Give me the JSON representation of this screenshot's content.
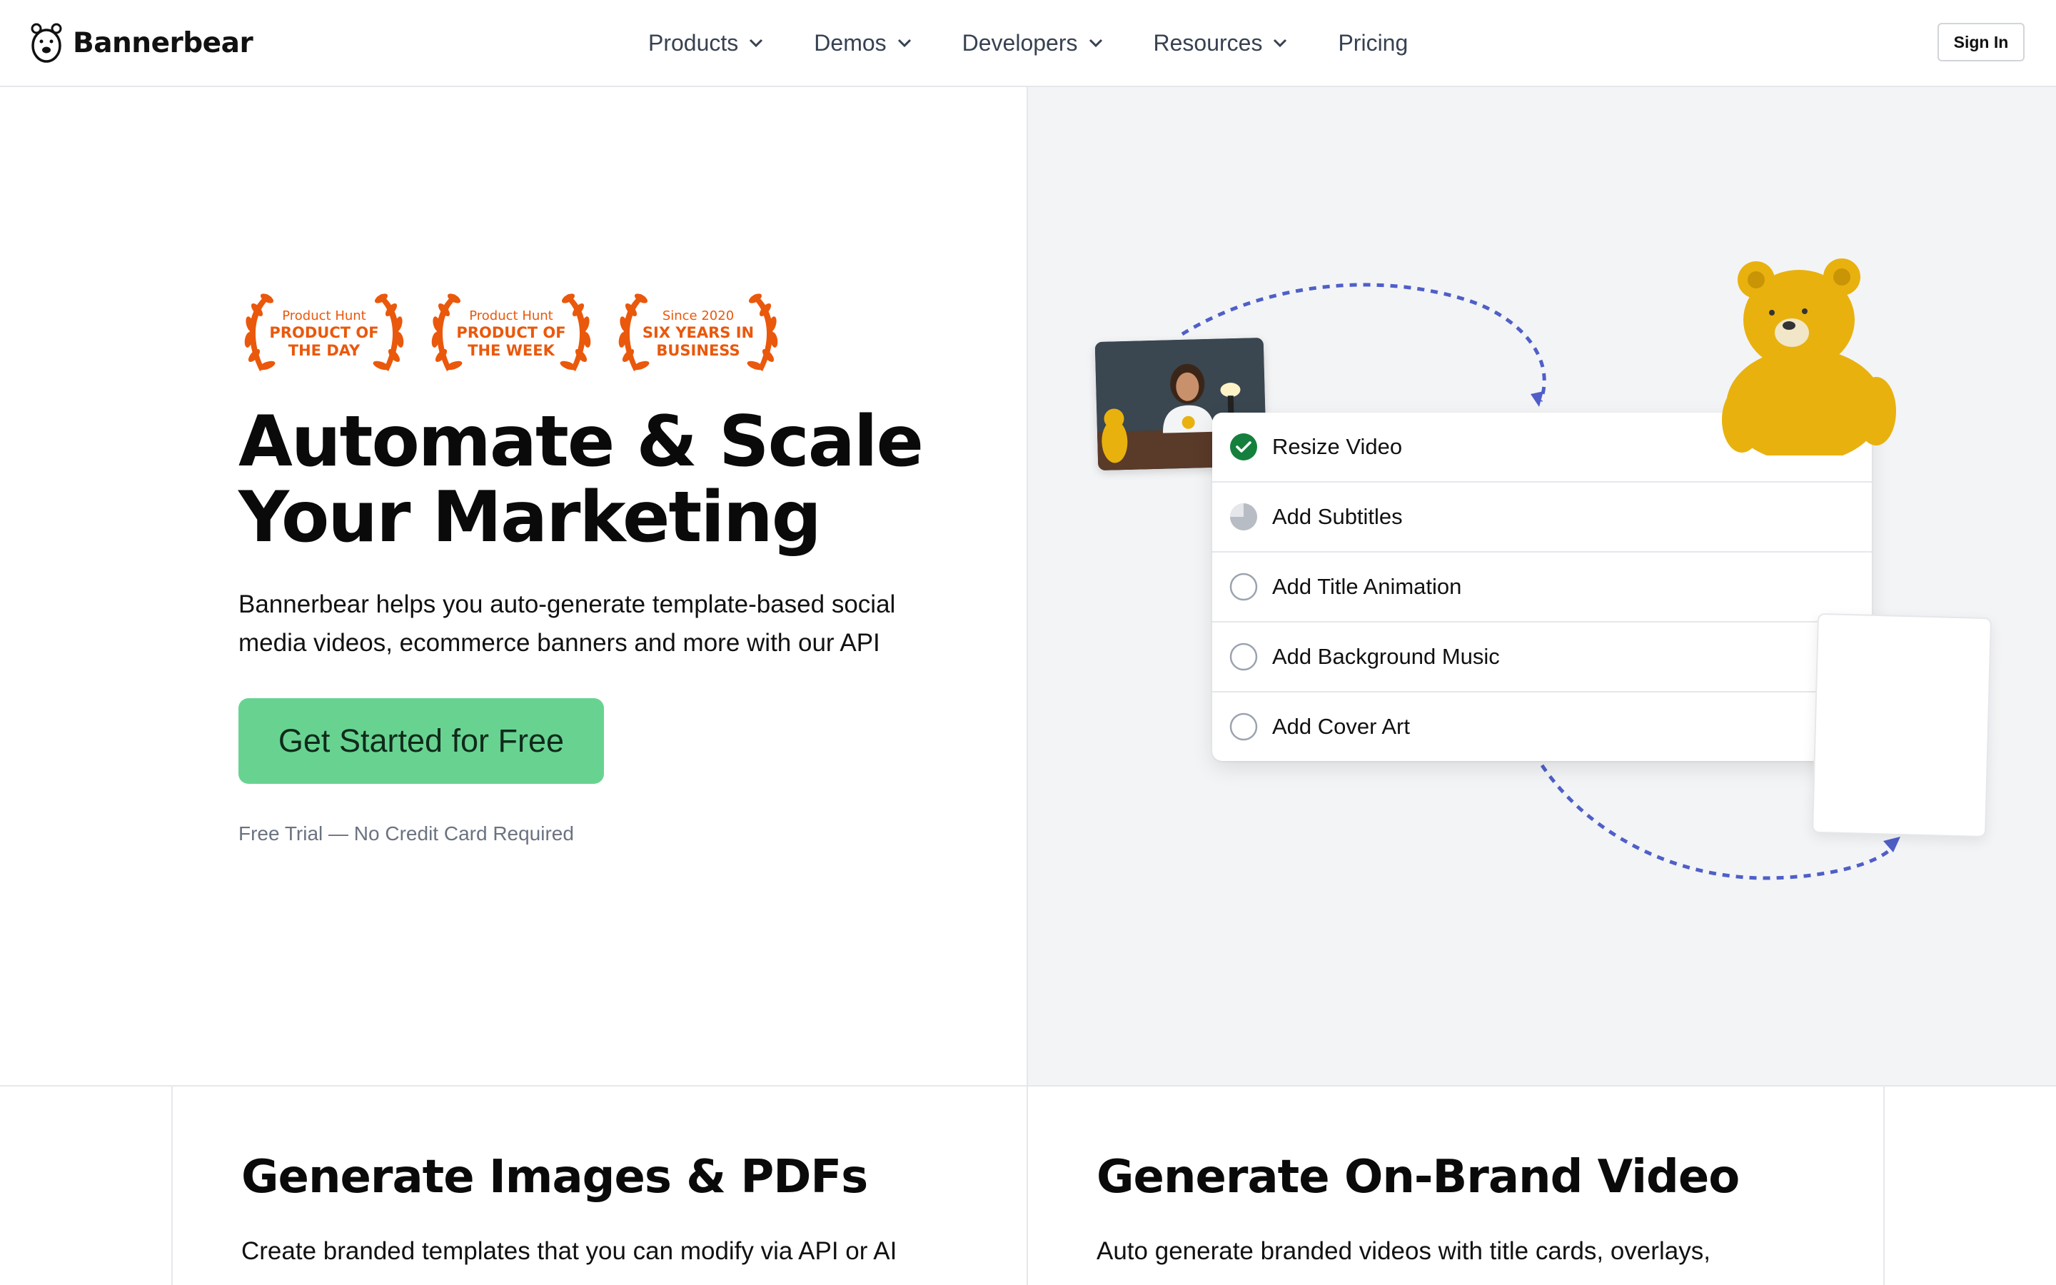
{
  "header": {
    "brand": "Bannerbear",
    "nav": [
      {
        "label": "Products",
        "dropdown": true
      },
      {
        "label": "Demos",
        "dropdown": true
      },
      {
        "label": "Developers",
        "dropdown": true
      },
      {
        "label": "Resources",
        "dropdown": true
      },
      {
        "label": "Pricing",
        "dropdown": false
      }
    ],
    "sign_in": "Sign In"
  },
  "hero": {
    "badges": [
      {
        "small": "Product Hunt",
        "line1": "PRODUCT OF",
        "line2": "THE DAY"
      },
      {
        "small": "Product Hunt",
        "line1": "PRODUCT OF",
        "line2": "THE WEEK"
      },
      {
        "small": "Since 2020",
        "line1": "SIX YEARS IN",
        "line2": "BUSINESS"
      }
    ],
    "headline_line1": "Automate & Scale",
    "headline_line2": "Your Marketing",
    "subtext": "Bannerbear helps you auto-generate template-based social media videos, ecommerce banners and more with our API",
    "cta": "Get Started for Free",
    "trial_note": "Free Trial — No Credit Card Required"
  },
  "workflow": {
    "tasks": [
      {
        "label": "Resize Video",
        "status": "done"
      },
      {
        "label": "Add Subtitles",
        "status": "in-progress"
      },
      {
        "label": "Add Title Animation",
        "status": "pending"
      },
      {
        "label": "Add Background Music",
        "status": "pending"
      },
      {
        "label": "Add Cover Art",
        "status": "pending"
      }
    ]
  },
  "features": [
    {
      "title": "Generate Images & PDFs",
      "text": "Create branded templates that you can modify via API or AI"
    },
    {
      "title": "Generate On-Brand Video",
      "text": "Auto generate branded videos with title cards, overlays,"
    }
  ],
  "colors": {
    "accent_green": "#68d391",
    "badge_orange": "#ea580c",
    "check_green": "#15803d",
    "arrow_blue": "#4f5fc7",
    "bear_yellow": "#e8b10e"
  }
}
